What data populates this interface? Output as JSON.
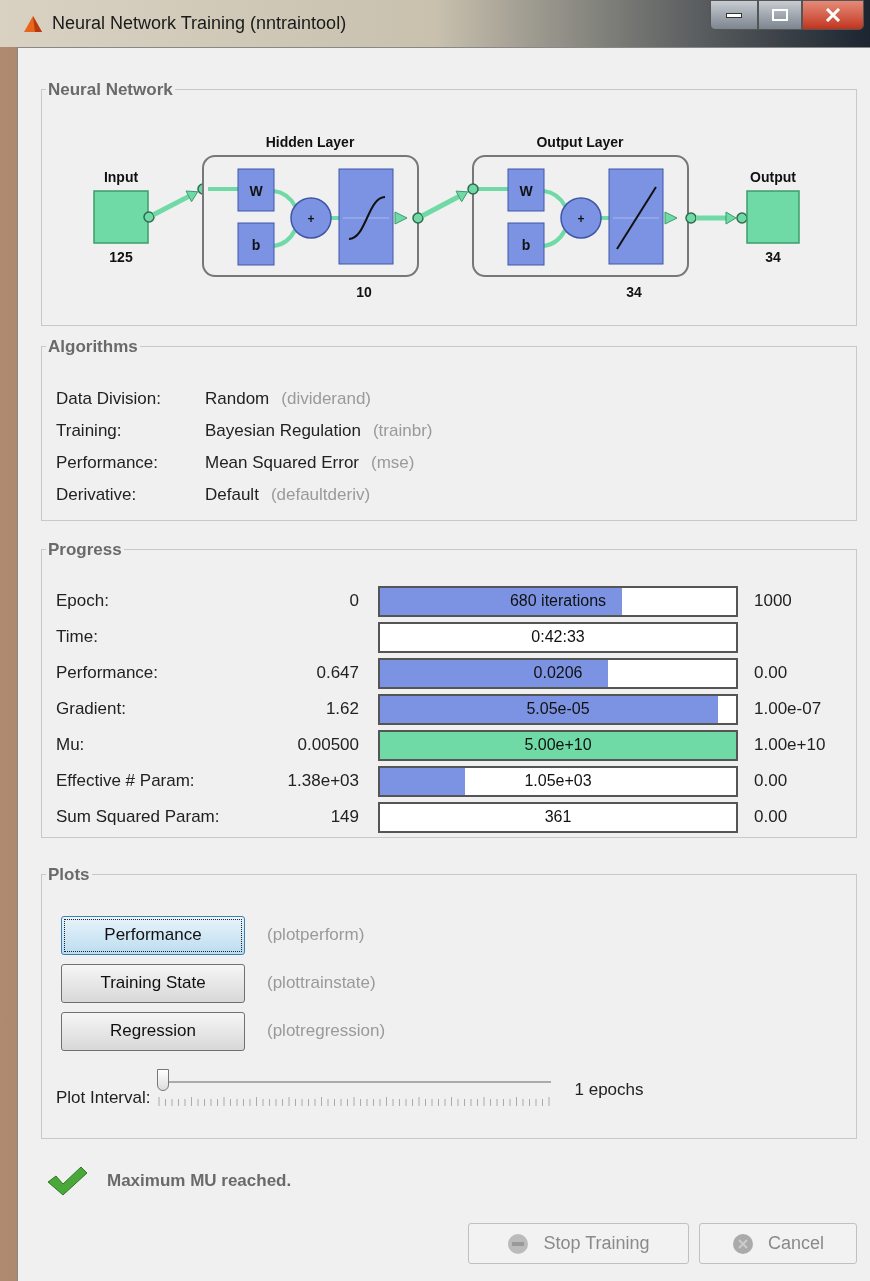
{
  "window": {
    "title": "Neural Network Training (nntraintool)"
  },
  "network": {
    "title": "Neural Network",
    "input": {
      "label": "Input",
      "size": "125"
    },
    "layers": [
      {
        "title": "Hidden Layer",
        "weight": "W",
        "bias": "b",
        "sum": "+",
        "kind": "sigmoid",
        "size": "10"
      },
      {
        "title": "Output Layer",
        "weight": "W",
        "bias": "b",
        "sum": "+",
        "kind": "linear",
        "size": "34"
      }
    ],
    "output": {
      "label": "Output",
      "size": "34"
    }
  },
  "algorithms": {
    "title": "Algorithms",
    "rows": [
      {
        "label": "Data Division:",
        "value": "Random",
        "function": "(dividerand)"
      },
      {
        "label": "Training:",
        "value": "Bayesian Regulation",
        "function": "(trainbr)"
      },
      {
        "label": "Performance:",
        "value": "Mean Squared Error",
        "function": "(mse)"
      },
      {
        "label": "Derivative:",
        "value": "Default",
        "function": "(defaultderiv)"
      }
    ]
  },
  "progress": {
    "title": "Progress",
    "rows": [
      {
        "label": "Epoch:",
        "start": "0",
        "reading": "680 iterations",
        "level": 0.68,
        "color": "#7b93e2",
        "end": "1000"
      },
      {
        "label": "Time:",
        "reading": "0:42:33"
      },
      {
        "label": "Performance:",
        "start": "0.647",
        "reading": "0.0206",
        "level": 0.64,
        "color": "#7b93e2",
        "end": "0.00"
      },
      {
        "label": "Gradient:",
        "start": "1.62",
        "reading": "5.05e-05",
        "level": 0.95,
        "color": "#7b93e2",
        "end": "1.00e-07"
      },
      {
        "label": "Mu:",
        "start": "0.00500",
        "reading": "5.00e+10",
        "level": 1,
        "color": "#6fdaa6",
        "end": "1.00e+10"
      },
      {
        "label": "Effective # Param:",
        "start": "1.38e+03",
        "reading": "1.05e+03",
        "level": 0.24,
        "color": "#7b93e2",
        "end": "0.00"
      },
      {
        "label": "Sum Squared Param:",
        "start": "149",
        "reading": "361",
        "end": "0.00"
      }
    ]
  },
  "plots": {
    "title": "Plots",
    "buttons": [
      {
        "label": "Performance",
        "function": "(plotperform)",
        "focused": true
      },
      {
        "label": "Training State",
        "function": "(plottrainstate)",
        "focused": false
      },
      {
        "label": "Regression",
        "function": "(plotregression)",
        "focused": false
      }
    ],
    "interval": {
      "label": "Plot Interval:",
      "level": 0,
      "reading": "1 epochs"
    }
  },
  "status": {
    "message": "Maximum MU reached."
  },
  "buttons": [
    {
      "label": "Stop Training",
      "kind": "stop",
      "disabled": true
    },
    {
      "label": "Cancel",
      "kind": "cancel",
      "disabled": true
    }
  ]
}
